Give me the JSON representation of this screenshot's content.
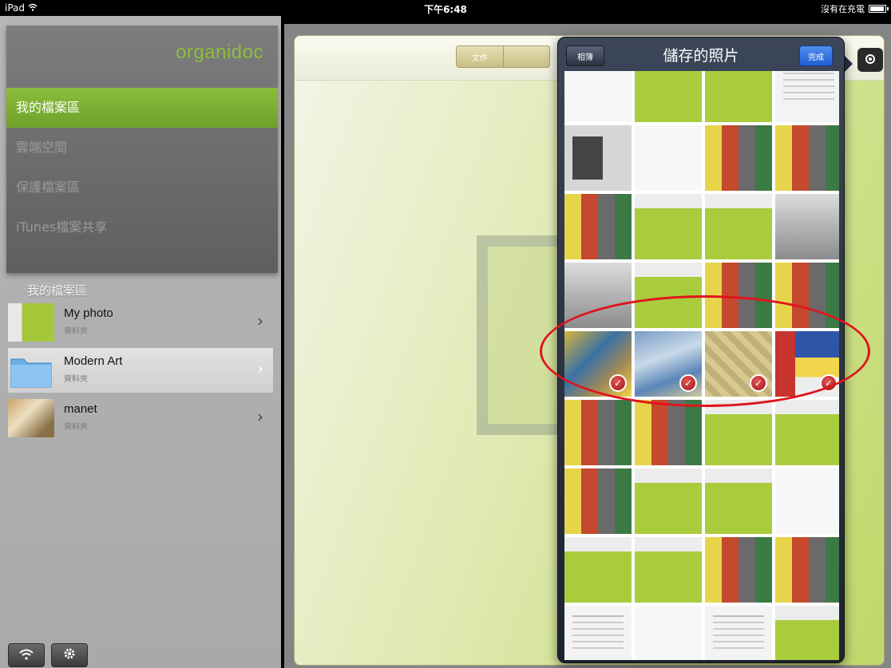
{
  "statusbar": {
    "device": "iPad",
    "time": "下午6:48",
    "charging": "沒有在充電",
    "battery_level": 0.85
  },
  "sidebar": {
    "logo": "organidoc",
    "nav_items": [
      {
        "label": "我的檔案區",
        "active": true
      },
      {
        "label": "雲端空間",
        "active": false
      },
      {
        "label": "保護檔案區",
        "active": false
      },
      {
        "label": "iTunes檔案共享",
        "active": false
      }
    ],
    "section_label": "我的檔案區",
    "folders": [
      {
        "name": "My photo",
        "sub": "資料夾",
        "selected": false
      },
      {
        "name": "Modern Art",
        "sub": "資料夾",
        "selected": true
      },
      {
        "name": "manet",
        "sub": "資料夾",
        "selected": false
      }
    ]
  },
  "main": {
    "segment_left": "文件"
  },
  "popover": {
    "title": "儲存的照片",
    "left_button": "相簿",
    "right_button": "完成"
  }
}
